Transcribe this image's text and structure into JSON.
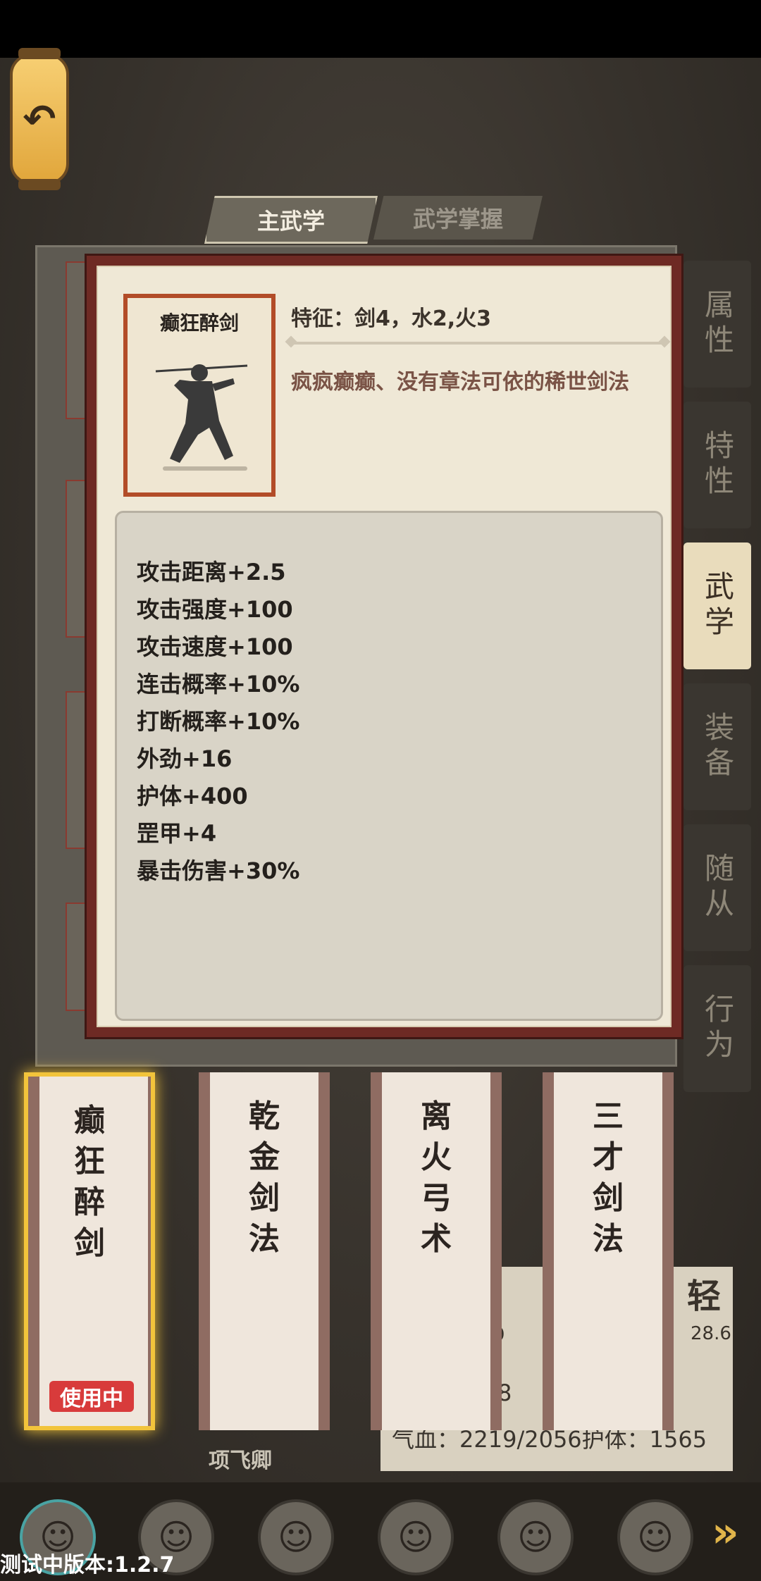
{
  "tabs": {
    "main": "主武学",
    "mastery": "武学掌握"
  },
  "side_tabs": [
    {
      "label": "属性",
      "active": false
    },
    {
      "label": "特性",
      "active": false
    },
    {
      "label": "武学",
      "active": true
    },
    {
      "label": "装备",
      "active": false
    },
    {
      "label": "随从",
      "active": false
    },
    {
      "label": "行为",
      "active": false
    }
  ],
  "popup": {
    "skill_name": "癫狂醉剑",
    "trait": "特征：剑4，水2,火3",
    "description": "疯疯癫癫、没有章法可依的稀世剑法",
    "stats": [
      "攻击距离+2.5",
      "攻击强度+100",
      "攻击速度+100",
      "连击概率+10%",
      "打断概率+10%",
      "外劲+16",
      "护体+400",
      "罡甲+4",
      "暴击伤害+30%"
    ]
  },
  "skills": [
    {
      "name": "癫狂醉剑",
      "chars": [
        "癫",
        "狂",
        "醉",
        "剑"
      ],
      "in_use": true
    },
    {
      "name": "乾金剑法",
      "chars": [
        "乾",
        "金",
        "剑",
        "法"
      ],
      "in_use": false
    },
    {
      "name": "离火弓术",
      "chars": [
        "离",
        "火",
        "弓",
        "术"
      ],
      "in_use": false
    },
    {
      "name": "三才剑法",
      "chars": [
        "三",
        "才",
        "剑",
        "法"
      ],
      "in_use": false
    }
  ],
  "in_use_label": "使用中",
  "character": {
    "name": "项飞卿",
    "hp_line": "气血：2219/2056护体：1565",
    "light_label": "轻",
    "light_value": "28.6",
    "partial_value_1": "9",
    "partial_value_2": "8"
  },
  "version": "测试中版本:1.2.7",
  "colors": {
    "accent": "#f2c43b",
    "popup_border": "#6e2a24",
    "in_use": "#d83b3b"
  }
}
